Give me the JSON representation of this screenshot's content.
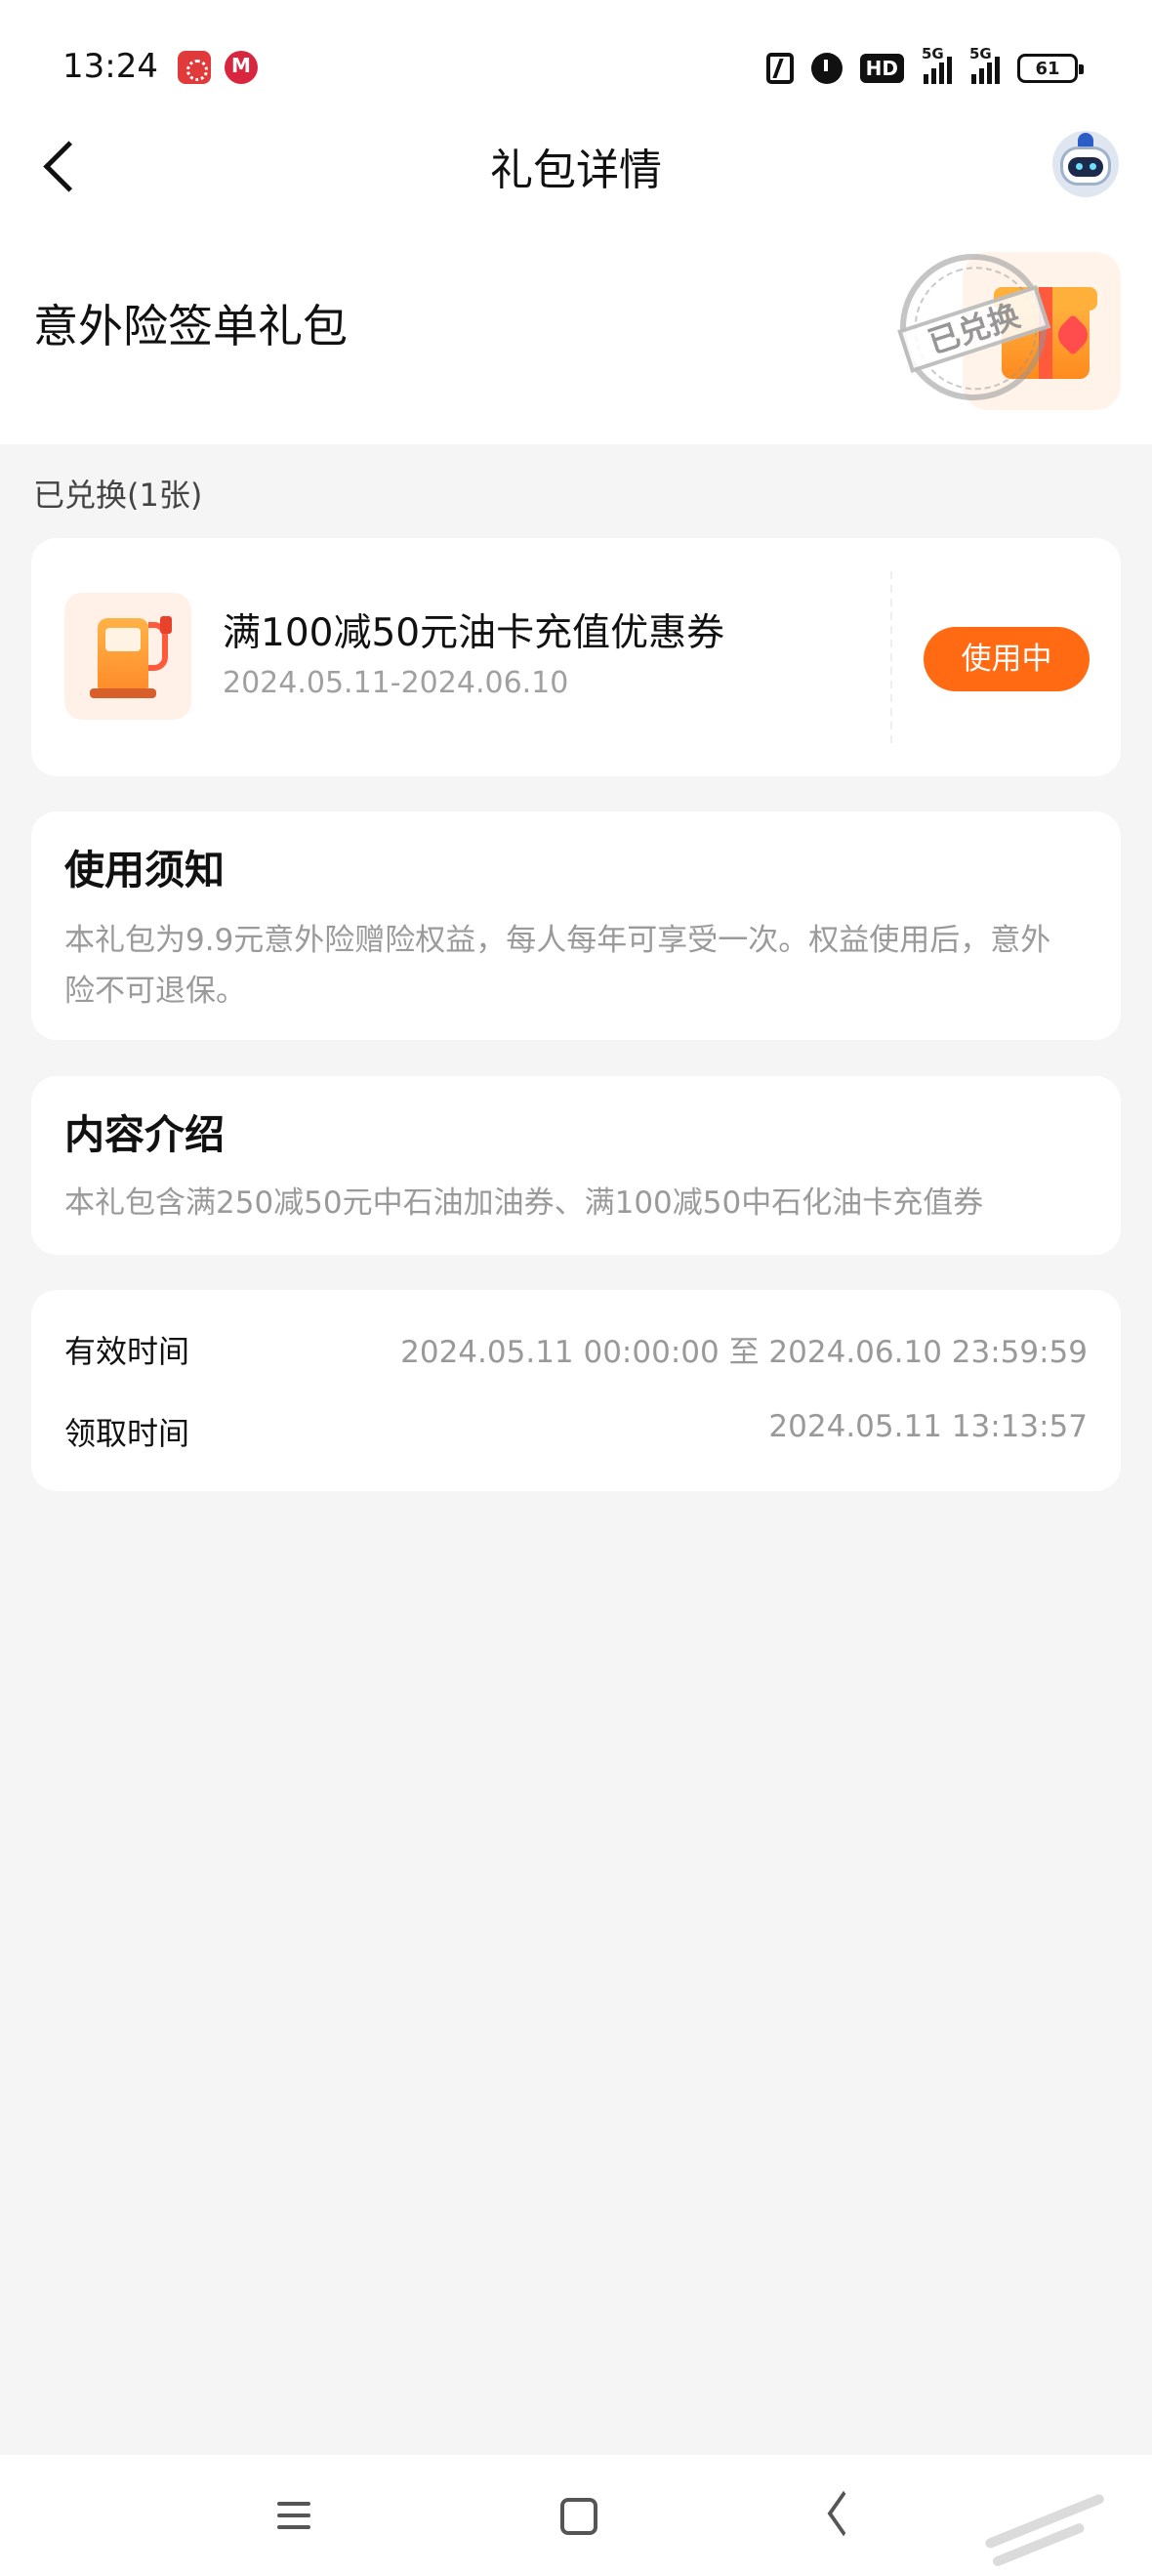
{
  "status_bar": {
    "time": "13:24",
    "hd_label": "HD",
    "network_1": "5G",
    "network_2": "5G",
    "battery": "61"
  },
  "nav": {
    "title": "礼包详情"
  },
  "gift": {
    "title": "意外险签单礼包",
    "stamp": "已兑换"
  },
  "section_label": "已兑换(1张)",
  "coupon": {
    "name": "满100减50元油卡充值优惠券",
    "validity": "2024.05.11-2024.06.10",
    "status_button": "使用中"
  },
  "notice": {
    "heading": "使用须知",
    "body": "本礼包为9.9元意外险赠险权益，每人每年可享受一次。权益使用后，意外险不可退保。"
  },
  "intro": {
    "heading": "内容介绍",
    "body": "本礼包含满250减50元中石油加油券、满100减50中石化油卡充值券"
  },
  "times": {
    "valid_label": "有效时间",
    "valid_value": "2024.05.11 00:00:00 至 2024.06.10 23:59:59",
    "claim_label": "领取时间",
    "claim_value": "2024.05.11 13:13:57"
  },
  "colors": {
    "accent": "#ff6a13",
    "background": "#f5f5f5",
    "muted_text": "#9a9a9a"
  }
}
